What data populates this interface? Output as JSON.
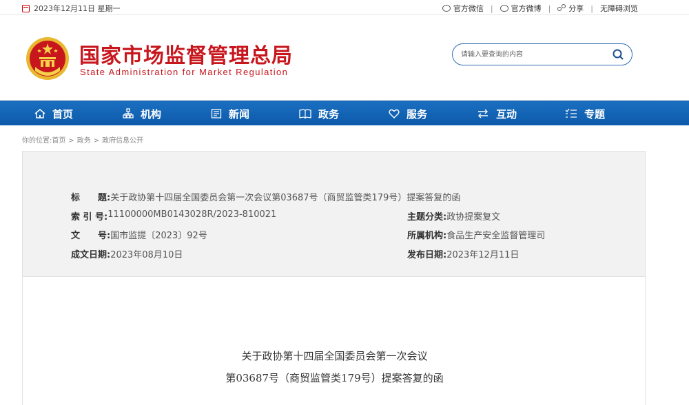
{
  "topbar": {
    "date": "2023年12月11日 星期一",
    "links": [
      {
        "label": "官方微信",
        "icon": "wechat-icon"
      },
      {
        "label": "官方微博",
        "icon": "weibo-icon"
      },
      {
        "label": "分享",
        "icon": "share-icon"
      },
      {
        "label": "无障碍浏览",
        "icon": ""
      }
    ],
    "separator": "|"
  },
  "header": {
    "title_cn": "国家市场监督管理总局",
    "title_en": "State Administration for Market Regulation",
    "search_placeholder": "请输入要查询的内容"
  },
  "nav": {
    "items": [
      {
        "label": "首页",
        "icon": "home-icon"
      },
      {
        "label": "机构",
        "icon": "org-icon"
      },
      {
        "label": "新闻",
        "icon": "news-icon"
      },
      {
        "label": "政务",
        "icon": "affairs-icon"
      },
      {
        "label": "服务",
        "icon": "heart-icon"
      },
      {
        "label": "互动",
        "icon": "exchange-icon"
      },
      {
        "label": "专题",
        "icon": "list-icon"
      }
    ]
  },
  "breadcrumb": {
    "prefix": "你的位置:",
    "items": [
      "首页",
      "政务",
      "政府信息公开"
    ],
    "separator": ">"
  },
  "info": {
    "title_label": "标　　题:",
    "title_value": "关于政协第十四届全国委员会第一次会议第03687号（商贸监管类179号）提案答复的函",
    "index_label": "索 引 号:",
    "index_value": "11100000MB0143028R/2023-810021",
    "topic_label": "主题分类:",
    "topic_value": "政协提案复文",
    "docno_label": "文　　号:",
    "docno_value": "国市监提〔2023〕92号",
    "org_label": "所属机构:",
    "org_value": "食品生产安全监督管理司",
    "created_label": "成文日期:",
    "created_value": "2023年08月10日",
    "published_label": "发布日期:",
    "published_value": "2023年12月11日"
  },
  "document": {
    "title_line1": "关于政协第十四届全国委员会第一次会议",
    "title_line2": "第03687号（商贸监管类179号）提案答复的函"
  },
  "colors": {
    "brand_red": "#c8161d",
    "nav_blue": "#1566b8",
    "search_border": "#2f6eb5"
  }
}
